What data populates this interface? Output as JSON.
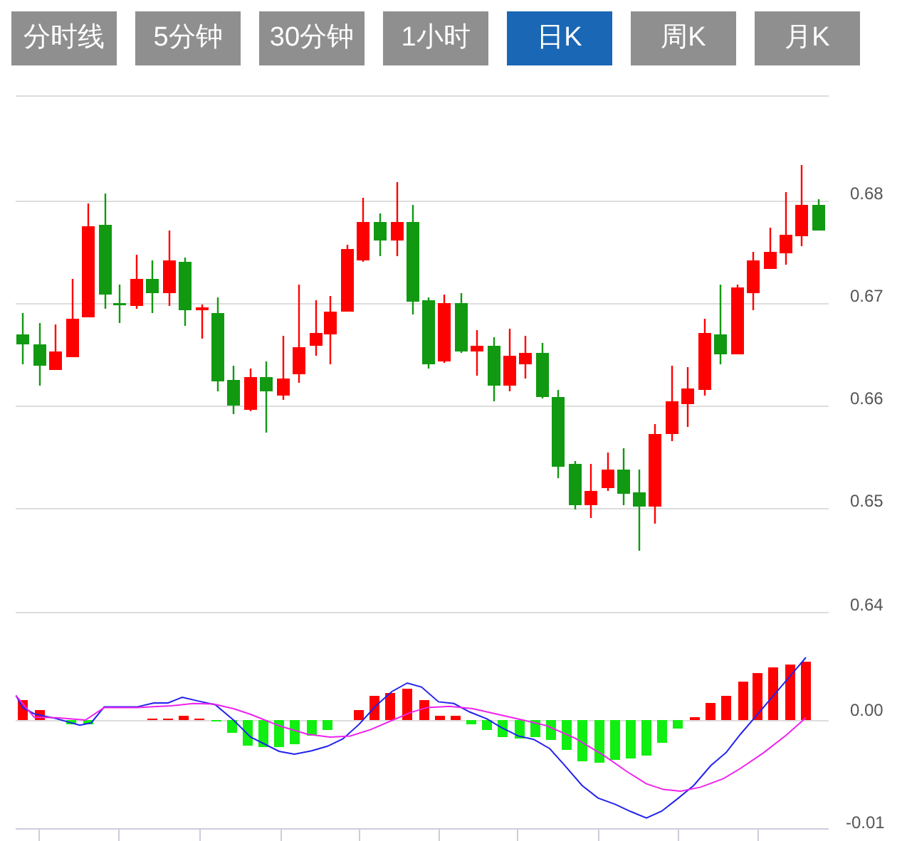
{
  "tabs": [
    {
      "label": "分时线",
      "selected": false
    },
    {
      "label": "5分钟",
      "selected": false
    },
    {
      "label": "30分钟",
      "selected": false
    },
    {
      "label": "1小时",
      "selected": false
    },
    {
      "label": "日K",
      "selected": true
    },
    {
      "label": "周K",
      "selected": false
    },
    {
      "label": "月K",
      "selected": false
    }
  ],
  "price_axis": {
    "labels": [
      "0.68",
      "0.67",
      "0.66",
      "0.65",
      "0.64"
    ]
  },
  "indicator_axis": {
    "labels": [
      "0.00",
      "-0.01"
    ]
  }
}
